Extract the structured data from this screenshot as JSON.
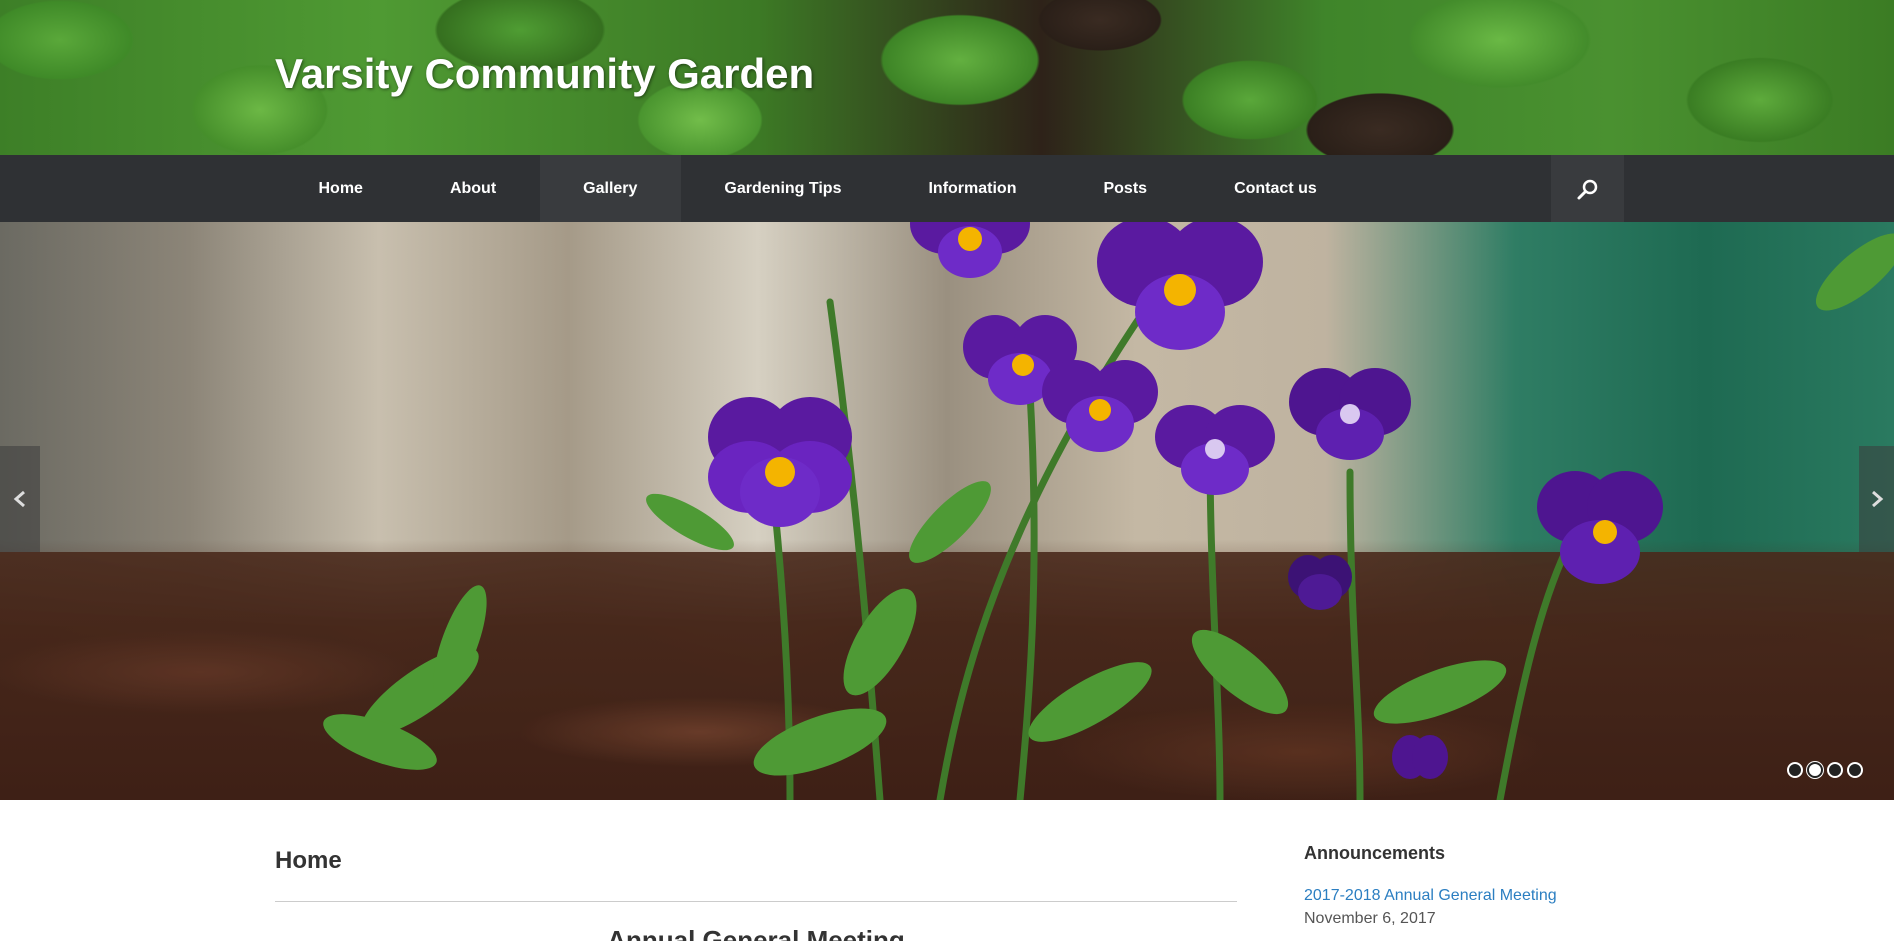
{
  "site": {
    "title": "Varsity Community Garden"
  },
  "nav": {
    "items": [
      {
        "label": "Home"
      },
      {
        "label": "About"
      },
      {
        "label": "Gallery"
      },
      {
        "label": "Gardening Tips"
      },
      {
        "label": "Information"
      },
      {
        "label": "Posts"
      },
      {
        "label": "Contact us"
      }
    ],
    "active": "Gallery",
    "search_icon": "search-icon"
  },
  "slider": {
    "slide_count": 4,
    "active_slide": 2,
    "prev_icon": "chevron-left-icon",
    "next_icon": "chevron-right-icon"
  },
  "main": {
    "page_title": "Home",
    "heading": "Annual General Meeting"
  },
  "sidebar": {
    "widget_title": "Announcements",
    "items": [
      {
        "title": "2017-2018 Annual General Meeting",
        "date": "November 6, 2017"
      }
    ]
  },
  "colors": {
    "nav_bg": "#2f3134",
    "link": "#2b7ec1",
    "title": "#ffffff"
  }
}
